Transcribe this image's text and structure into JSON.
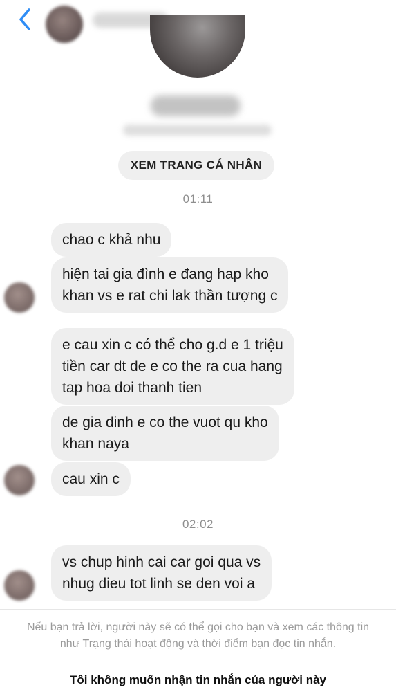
{
  "header": {
    "back_icon": "chevron-left-icon",
    "accent_color": "#2f8df6"
  },
  "profile": {
    "view_profile_label": "XEM TRANG CÁ NHÂN"
  },
  "conversation": {
    "timestamp_1": "01:11",
    "timestamp_2": "02:02",
    "messages": [
      {
        "lines": [
          "chao c khả nhu"
        ]
      },
      {
        "lines": [
          "hiện tai gia đình e đang hap kho",
          "khan vs e rat chi lak thần tượng  c"
        ]
      },
      {
        "lines": [
          "e cau xin c có  thể cho g.d e 1 triệu",
          "tiền car dt de e co the ra cua hang",
          "tap hoa doi thanh tien"
        ]
      },
      {
        "lines": [
          "de gia dinh e co the vuot qu kho",
          "khan naya"
        ]
      },
      {
        "lines": [
          "cau xin c"
        ]
      },
      {
        "lines": [
          "vs chup hinh cai car goi qua vs",
          "nhug dieu tot linh se den voi a"
        ]
      }
    ]
  },
  "footer": {
    "note": "Nếu bạn trả lời, người này sẽ có thể gọi cho bạn và xem các thông tin như Trạng thái hoạt động và thời điểm bạn đọc tin nhắn.",
    "action_label": "Tôi không muốn nhận tin nhắn của người này"
  }
}
